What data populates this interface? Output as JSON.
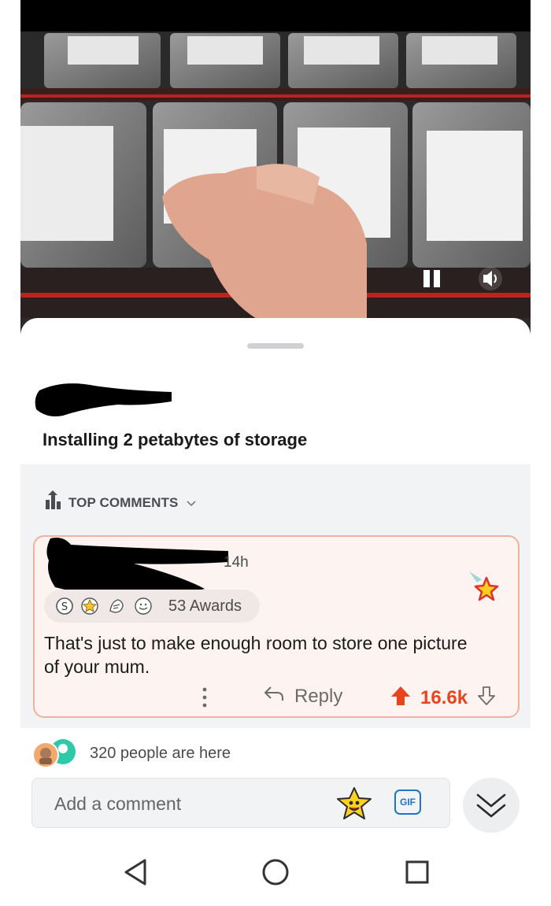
{
  "post": {
    "title": "Installing 2 petabytes of storage"
  },
  "video_controls": {
    "pause_icon": "pause-icon",
    "volume_icon": "volume-icon"
  },
  "comments": {
    "sort_label": "TOP COMMENTS",
    "sort_icon": "chevron-down-icon",
    "top_comment": {
      "time": "14h",
      "awards_label": "53 Awards",
      "award_icons": [
        "silver-award-icon",
        "gold-star-award-icon",
        "helpful-award-icon",
        "wholesome-award-icon"
      ],
      "body": "That's just to make enough room to store one picture of your mum.",
      "reply_label": "Reply",
      "score": "16.6k"
    }
  },
  "presence": {
    "text": "320 people are here"
  },
  "composer": {
    "placeholder": "Add a comment",
    "gif_label": "GIF"
  },
  "colors": {
    "upvote": "#e6451e",
    "gif_blue": "#1f73c9",
    "card_border": "#f3b19c",
    "card_bg": "#fdf4f1"
  }
}
